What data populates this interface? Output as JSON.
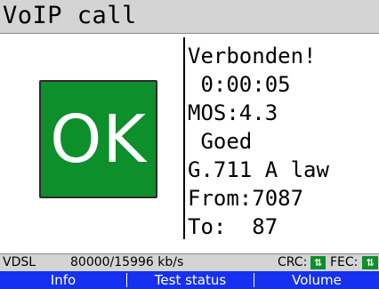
{
  "title": "VoIP call",
  "ok_label": "OK",
  "info": {
    "status": "Verbonden!",
    "duration": " 0:00:05",
    "mos": "MOS:4.3",
    "quality": " Goed",
    "codec": "G.711 A law",
    "from": "From:7087",
    "to": "To:  87"
  },
  "statusbar": {
    "line_type": "VDSL",
    "rate": "80000/15996 kb/s",
    "crc_label": "CRC:",
    "crc_icon": "up-down-arrows-icon",
    "fec_label": "FEC:",
    "fec_icon": "up-down-arrows-icon",
    "badge_color": "#0d8f2c"
  },
  "softkeys": [
    "Info",
    "Test status",
    "Volume"
  ],
  "colors": {
    "ok_green": "#0d8f2c",
    "softkey_bar": "#1530ee",
    "title_bar": "#d4d4d4"
  }
}
